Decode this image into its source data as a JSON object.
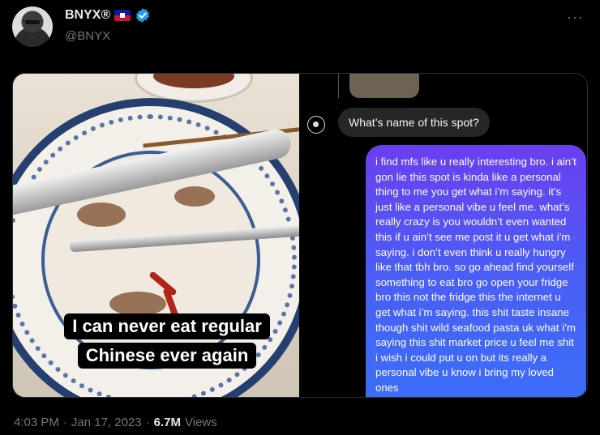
{
  "author": {
    "display_name": "BNYX®",
    "handle": "@BNYX",
    "flag_icon": "haiti-flag-icon",
    "verified_icon": "verified-badge-icon",
    "verified_color": "#1d9bf0"
  },
  "header": {
    "more_icon": "more-options-icon",
    "more_label": "···"
  },
  "media": {
    "caption_line1": "I can never eat regular",
    "caption_line2": "Chinese ever again",
    "incoming_message": "What’s name of this spot?",
    "outgoing_message": "i find mfs like u really interesting bro. i ain’t gon lie this spot is kinda like a personal thing to me you get what i’m saying. it’s just like a personal vibe u feel me. what’s really crazy is you wouldn’t even wanted this if u ain’t see me post it u get what i’m saying. i don’t even think u really hungry like that tbh bro. so go ahead find yourself something to eat bro go open your fridge bro this not the fridge this the internet u get what i’m saying. this shit taste insane though shit wild seafood pasta uk what i’m saying this shit market price u feel me shit i wish i could put u on but its really a personal vibe u know i bring my loved ones",
    "bubble_gradient": [
      "#6a3ef0",
      "#3a6ef6"
    ]
  },
  "meta": {
    "time": "4:03 PM",
    "sep1": "·",
    "date": "Jan 17, 2023",
    "sep2": "·",
    "views_count": "6.7M",
    "views_label": "Views"
  }
}
